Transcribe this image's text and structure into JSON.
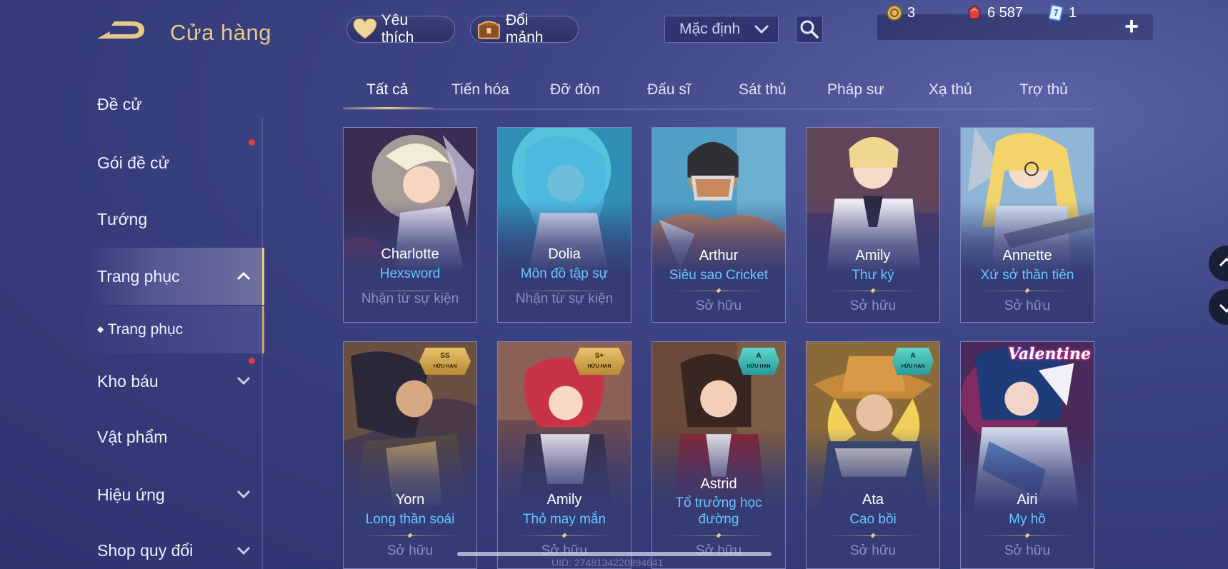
{
  "header": {
    "title": "Cửa hàng",
    "favorite_label": "Yêu thích",
    "exchange_label": "Đổi mảnh",
    "sort_value": "Mặc định"
  },
  "currency": {
    "voucher": "3",
    "coupon": "6 587",
    "card": "1"
  },
  "sidebar": {
    "items": [
      {
        "label": "Đề cử"
      },
      {
        "label": "Gói đề cử"
      },
      {
        "label": "Tướng"
      },
      {
        "label": "Trang phục"
      },
      {
        "label": "Trang phục"
      },
      {
        "label": "Kho báu"
      },
      {
        "label": "Vật phẩm"
      },
      {
        "label": "Hiệu ứng"
      },
      {
        "label": "Shop quy đổi"
      }
    ]
  },
  "tabs": [
    "Tất cả",
    "Tiến hóa",
    "Đỡ đòn",
    "Đấu sĩ",
    "Sát thủ",
    "Pháp sư",
    "Xạ thủ",
    "Trợ thủ"
  ],
  "cards": [
    {
      "hero": "Charlotte",
      "skin": "Hexsword",
      "status": "Nhận từ sự kiện",
      "badge": "",
      "badge_sub": ""
    },
    {
      "hero": "Dolia",
      "skin": "Môn đồ tập sự",
      "status": "Nhận từ sự kiện",
      "badge": "",
      "badge_sub": ""
    },
    {
      "hero": "Arthur",
      "skin": "Siêu sao Cricket",
      "status": "Sở hữu",
      "badge": "",
      "badge_sub": ""
    },
    {
      "hero": "Amily",
      "skin": "Thư ký",
      "status": "Sở hữu",
      "badge": "",
      "badge_sub": ""
    },
    {
      "hero": "Annette",
      "skin": "Xứ sở thần tiên",
      "status": "Sở hữu",
      "badge": "",
      "badge_sub": ""
    },
    {
      "hero": "Yorn",
      "skin": "Long thần soái",
      "status": "Sở hữu",
      "badge": "SS",
      "badge_sub": "HỮU HẠN"
    },
    {
      "hero": "Amily",
      "skin": "Thỏ may mắn",
      "status": "Sở hữu",
      "badge": "S+",
      "badge_sub": "HỮU HẠN"
    },
    {
      "hero": "Astrid",
      "skin": "Tổ trưởng học đường",
      "status": "Sở hữu",
      "badge": "A",
      "badge_sub": "HỮU HẠN"
    },
    {
      "hero": "Ata",
      "skin": "Cao bồi",
      "status": "Sở hữu",
      "badge": "A",
      "badge_sub": "HỮU HẠN"
    },
    {
      "hero": "Airi",
      "skin": "My hồ",
      "status": "Sở hữu",
      "badge": "",
      "badge_sub": "",
      "tag": "Valentine"
    }
  ],
  "footer": {
    "uid": "UID: 2748134220894641"
  },
  "colors": {
    "accent_gold": "#e9c98a",
    "skin_name_blue": "#67c7ff",
    "notification_red": "#e43b3b"
  }
}
